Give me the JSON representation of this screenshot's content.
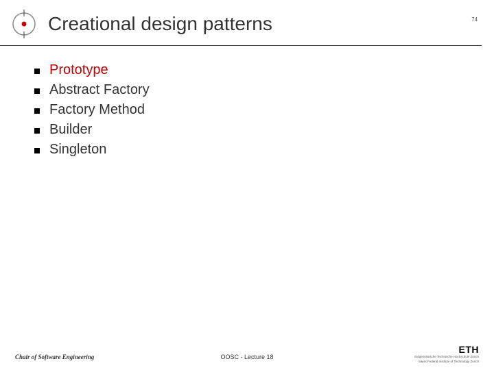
{
  "header": {
    "title": "Creational design patterns",
    "page_number": "74"
  },
  "bullets": [
    {
      "text": "Prototype",
      "highlight": true
    },
    {
      "text": "Abstract Factory",
      "highlight": false
    },
    {
      "text": "Factory Method",
      "highlight": false
    },
    {
      "text": "Builder",
      "highlight": false
    },
    {
      "text": "Singleton",
      "highlight": false
    }
  ],
  "footer": {
    "left": "Chair of Software Engineering",
    "center": "OOSC - Lecture 18",
    "right_logo": "ETH",
    "right_sub1": "Eidgenössische Technische Hochschule Zürich",
    "right_sub2": "Swiss Federal Institute of Technology Zurich"
  }
}
